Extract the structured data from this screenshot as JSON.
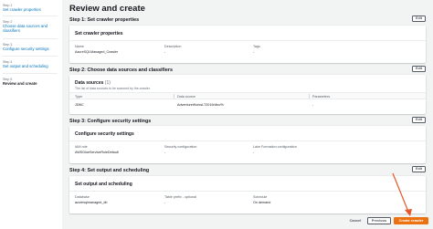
{
  "sidebar": {
    "steps": [
      {
        "num": "Step 1",
        "label": "Set crawler properties"
      },
      {
        "num": "Step 2",
        "label": "Choose data sources and classifiers"
      },
      {
        "num": "Step 3",
        "label": "Configure security settings"
      },
      {
        "num": "Step 4",
        "label": "Set output and scheduling"
      },
      {
        "num": "Step 5",
        "label": "Review and create"
      }
    ]
  },
  "page": {
    "title": "Review and create"
  },
  "step1": {
    "title": "Step 1: Set crawler properties",
    "edit": "Edit",
    "card_title": "Set crawler properties",
    "fields": [
      {
        "label": "Name",
        "value": "AzureSQLManaged_Crawler"
      },
      {
        "label": "Description",
        "value": "-"
      },
      {
        "label": "Tags",
        "value": "-"
      }
    ]
  },
  "step2": {
    "title": "Step 2: Choose data sources and classifiers",
    "edit": "Edit",
    "card_title": "Data sources",
    "count": "(1)",
    "description": "The list of data sources to be scanned by the crawler.",
    "columns": [
      "Type",
      "Data source",
      "Parameters"
    ],
    "rows": [
      [
        "JDBC",
        "AdventureWorksLT2019/dbo/%",
        "-"
      ]
    ]
  },
  "step3": {
    "title": "Step 3: Configure security settings",
    "edit": "Edit",
    "card_title": "Configure security settings",
    "fields": [
      {
        "label": "IAM role",
        "value": "AWSGlueServiceRoleDefault"
      },
      {
        "label": "Security configuration",
        "value": "-"
      },
      {
        "label": "Lake Formation configuration",
        "value": "-"
      }
    ]
  },
  "step4": {
    "title": "Step 4: Set output and scheduling",
    "edit": "Edit",
    "card_title": "Set output and scheduling",
    "fields": [
      {
        "label": "Database",
        "value": "azuresqlmanaged_db"
      },
      {
        "label": "Table prefix - optional",
        "value": "-"
      },
      {
        "label": "Schedule",
        "value": "On demand"
      }
    ]
  },
  "footer": {
    "cancel": "Cancel",
    "previous": "Previous",
    "create": "Create crawler"
  },
  "colors": {
    "link": "#0073bb",
    "primary": "#ec7211",
    "annotation_arrow": "#e8572a"
  }
}
